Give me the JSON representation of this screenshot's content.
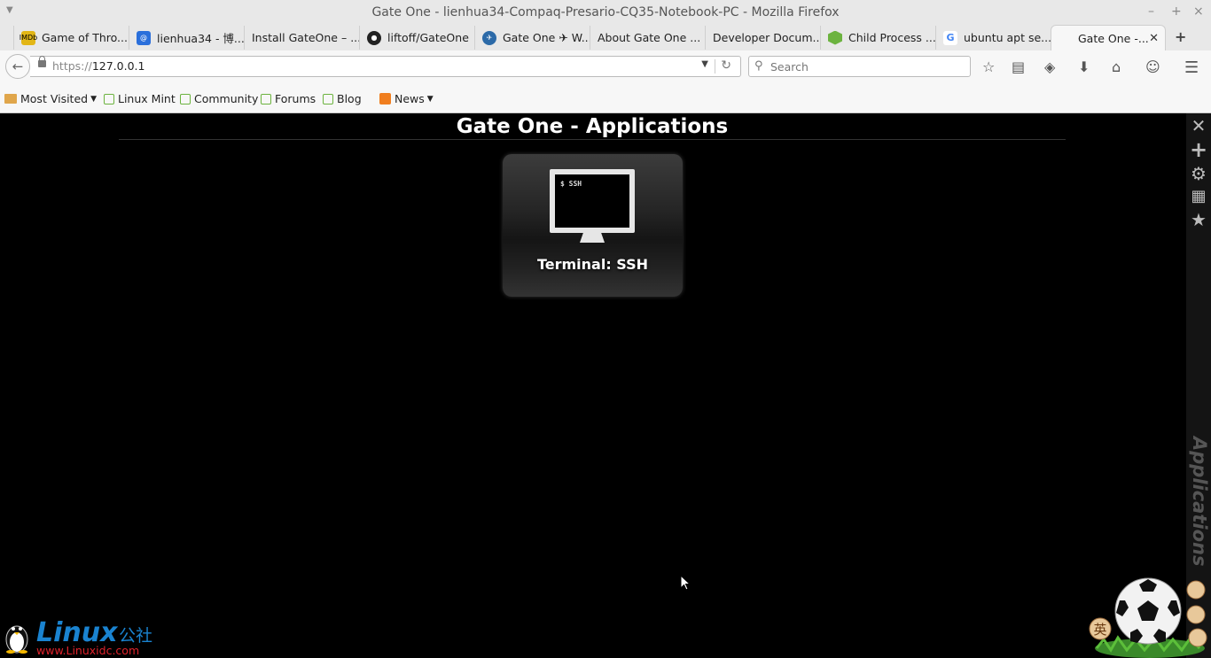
{
  "window": {
    "title": "Gate One - lienhua34-Compaq-Presario-CQ35-Notebook-PC - Mozilla Firefox"
  },
  "tabs": [
    {
      "label": "Game of Thro...",
      "icon": "imdb-icon"
    },
    {
      "label": "lienhua34 - 博...",
      "icon": "cnblogs-icon"
    },
    {
      "label": "Install GateOne – ...",
      "icon": "page-icon"
    },
    {
      "label": "liftoff/GateOne",
      "icon": "github-icon"
    },
    {
      "label": "Gate One ✈ W...",
      "icon": "gateone-icon"
    },
    {
      "label": "About Gate One ...",
      "icon": "page-icon"
    },
    {
      "label": "Developer Docum...",
      "icon": "page-icon"
    },
    {
      "label": "Child Process ...",
      "icon": "nodejs-icon"
    },
    {
      "label": "ubuntu apt se...",
      "icon": "google-icon"
    },
    {
      "label": "Gate One -...",
      "icon": "page-icon",
      "active": true
    }
  ],
  "navbar": {
    "url_scheme": "https://",
    "url_host": "127.0.0.1",
    "search_placeholder": "Search"
  },
  "bookmarks": [
    {
      "label": "Most Visited",
      "icon": "folder-icon",
      "dropdown": true
    },
    {
      "label": "Linux Mint",
      "icon": "mint-icon"
    },
    {
      "label": "Community",
      "icon": "mint-icon"
    },
    {
      "label": "Forums",
      "icon": "mint-icon"
    },
    {
      "label": "Blog",
      "icon": "mint-icon"
    },
    {
      "label": "News",
      "icon": "rss-icon",
      "dropdown": true
    }
  ],
  "gateone": {
    "title": "Gate One - Applications",
    "app_tile": {
      "label": "Terminal: SSH",
      "screen_text": "$ SSH"
    },
    "side_label": "Applications",
    "toolbar": [
      "close-icon",
      "new-terminal-icon",
      "settings-icon",
      "grid-icon",
      "bookmarks-icon"
    ]
  },
  "watermark": {
    "brand": "Linux",
    "brand_cn": "公社",
    "site": "www.Linuxidc.com"
  },
  "colors": {
    "brand_blue": "#1a83d0",
    "site_red": "#e0222b"
  }
}
